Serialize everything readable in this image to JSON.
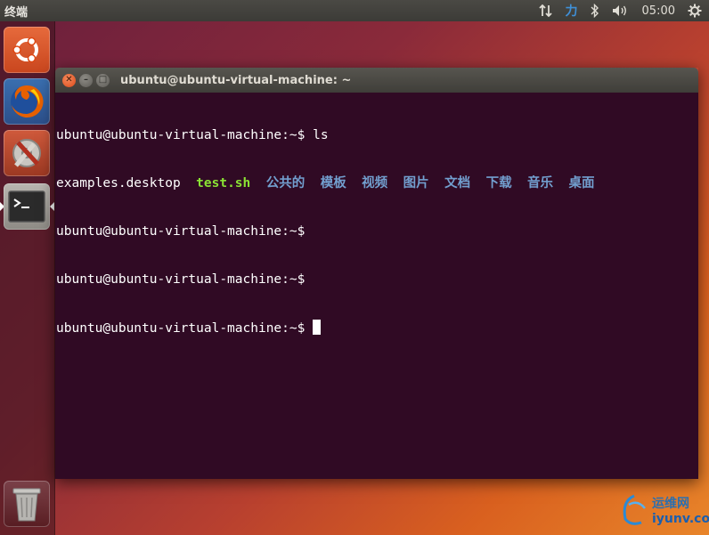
{
  "top_panel": {
    "app_title": "终端",
    "input_method": "力",
    "clock": "05:00"
  },
  "launcher": {
    "items": [
      {
        "name": "Ubuntu Dash"
      },
      {
        "name": "Firefox"
      },
      {
        "name": "System Settings"
      },
      {
        "name": "Terminal",
        "active": true
      },
      {
        "name": "Trash"
      }
    ]
  },
  "window": {
    "title": "ubuntu@ubuntu-virtual-machine: ~"
  },
  "terminal": {
    "line1_prompt": "ubuntu@ubuntu-virtual-machine:~$ ",
    "line1_cmd": "ls",
    "ls_output": [
      {
        "text": "examples.desktop",
        "type": "file"
      },
      {
        "text": "test.sh",
        "type": "executable"
      },
      {
        "text": "公共的",
        "type": "dir"
      },
      {
        "text": "模板",
        "type": "dir"
      },
      {
        "text": "视频",
        "type": "dir"
      },
      {
        "text": "图片",
        "type": "dir"
      },
      {
        "text": "文档",
        "type": "dir"
      },
      {
        "text": "下载",
        "type": "dir"
      },
      {
        "text": "音乐",
        "type": "dir"
      },
      {
        "text": "桌面",
        "type": "dir"
      }
    ],
    "line3": "ubuntu@ubuntu-virtual-machine:~$",
    "line4": "ubuntu@ubuntu-virtual-machine:~$",
    "line5_prompt": "ubuntu@ubuntu-virtual-machine:~$ "
  },
  "watermark": {
    "line1": "运维网",
    "line2": "iyunv.com"
  },
  "colors": {
    "terminal_bg": "#300a24",
    "executable": "#8ae234",
    "directory": "#729fcf"
  }
}
